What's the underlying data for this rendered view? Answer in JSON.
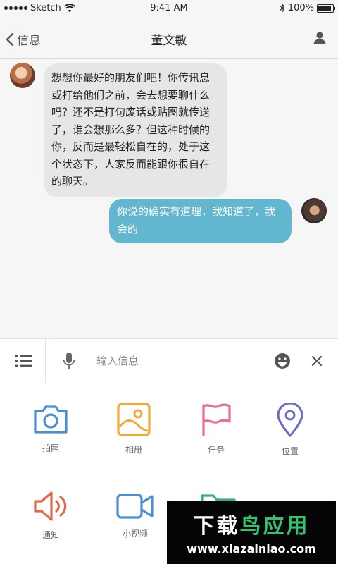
{
  "status_bar": {
    "carrier": "Sketch",
    "time": "9:41 AM",
    "battery": "100%",
    "battery_level": 1.0
  },
  "nav": {
    "back_label": "信息",
    "title": "董文敏"
  },
  "messages": [
    {
      "direction": "incoming",
      "text": "想想你最好的朋友们吧！你传讯息或打给他们之前，会去想要聊什么吗？还不是打句废话或贴图就传送了，谁会想那么多？但这种时候的你，反而是最轻松自在的，处于这个状态下，人家反而能跟你很自在的聊天。"
    },
    {
      "direction": "outgoing",
      "text": "你说的确实有道理，我知道了，我会的"
    }
  ],
  "input": {
    "placeholder": "输入信息",
    "value": ""
  },
  "panel": {
    "items": [
      {
        "label": "拍照",
        "icon": "camera-icon",
        "color": "#4a8fd4"
      },
      {
        "label": "相册",
        "icon": "album-icon",
        "color": "#f0a93a"
      },
      {
        "label": "任务",
        "icon": "flag-icon",
        "color": "#ea6b95"
      },
      {
        "label": "位置",
        "icon": "location-icon",
        "color": "#6e6cc9"
      },
      {
        "label": "通知",
        "icon": "speaker-icon",
        "color": "#e06a45"
      },
      {
        "label": "小视频",
        "icon": "video-icon",
        "color": "#4a8fd4"
      },
      {
        "label": "",
        "icon": "folder-icon",
        "color": "#39b27a"
      }
    ]
  },
  "watermark": {
    "title_part1": "下载",
    "title_part2": "鸟应用",
    "url": "www.xiazainiao.com"
  },
  "colors": {
    "incoming_bubble": "#e6e6e6",
    "outgoing_bubble": "#62b6cf",
    "background": "#f6f6f6"
  }
}
